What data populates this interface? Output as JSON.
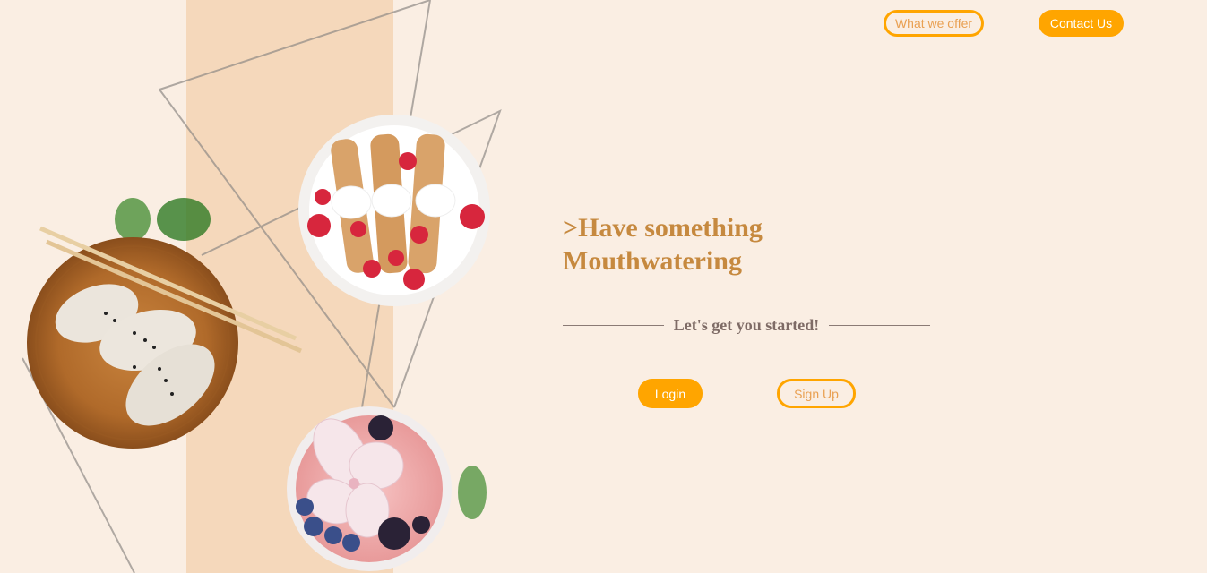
{
  "nav": {
    "what_we_offer": "What we offer",
    "contact_us": "Contact Us"
  },
  "hero": {
    "headline_line1": ">Have something",
    "headline_line2": "Mouthwatering",
    "tagline": "Let's get you started!"
  },
  "auth": {
    "login_label": "Login",
    "signup_label": "Sign Up"
  },
  "colors": {
    "background": "#faeee3",
    "stripe": "#f5d8bb",
    "accent": "#ffa500",
    "headline": "#c6893f",
    "tagline": "#7e6b66"
  },
  "images": [
    "dumplings-bowl-image",
    "crepes-plate-image",
    "smoothie-bowl-image",
    "leaf-decoration"
  ]
}
